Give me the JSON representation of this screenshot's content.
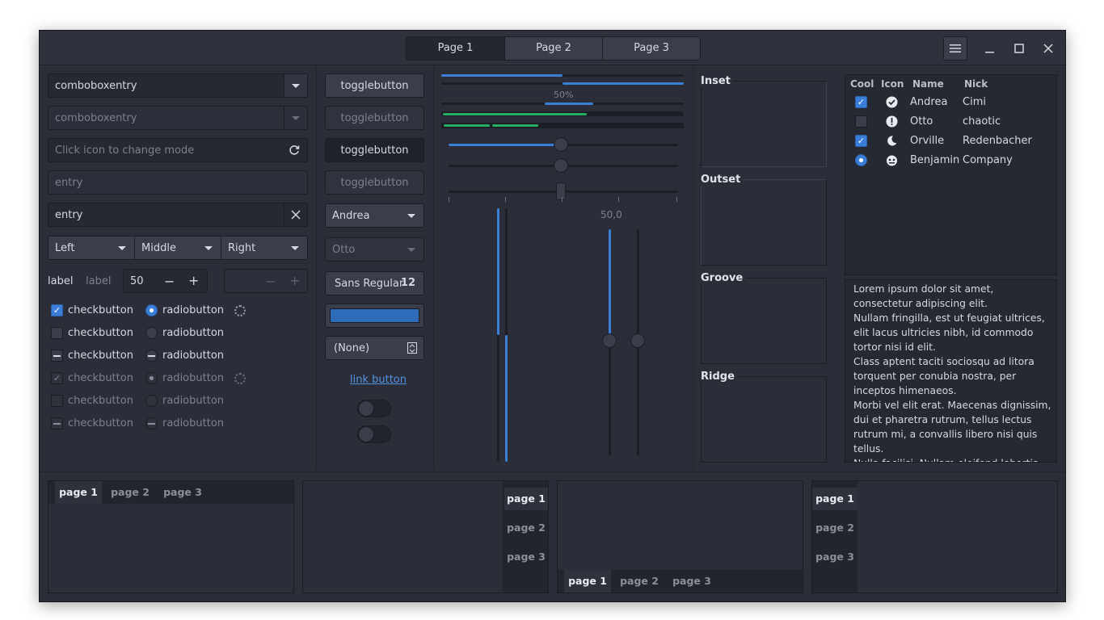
{
  "header": {
    "stack_tabs": [
      "Page 1",
      "Page 2",
      "Page 3"
    ]
  },
  "entries": {
    "combo1": "comboboxentry",
    "combo2": "comboboxentry",
    "mode_placeholder": "Click icon to change mode",
    "entry_placeholder": "entry",
    "entry_value": "entry",
    "seg": [
      "Left",
      "Middle",
      "Right"
    ],
    "label1": "label",
    "label2": "label",
    "spin_value": "50"
  },
  "checks": [
    "checkbutton",
    "checkbutton",
    "checkbutton",
    "checkbutton",
    "checkbutton",
    "checkbutton"
  ],
  "radios": [
    "radiobutton",
    "radiobutton",
    "radiobutton",
    "radiobutton",
    "radiobutton",
    "radiobutton"
  ],
  "buttons": {
    "toggles": [
      "togglebutton",
      "togglebutton",
      "togglebutton",
      "togglebutton"
    ],
    "combo_andrea": "Andrea",
    "combo_otto": "Otto",
    "font_name": "Sans Regular",
    "font_size": "12",
    "file_none": "(None)",
    "link": "link button"
  },
  "progress": {
    "label": "50%",
    "value": 0.5
  },
  "scale_value": "50,0",
  "frames": [
    "Inset",
    "Outset",
    "Groove",
    "Ridge"
  ],
  "tree": {
    "headers": [
      "Cool",
      "Icon",
      "Name",
      "Nick"
    ],
    "rows": [
      {
        "name": "Andrea",
        "nick": "Cimi",
        "cool": "checked",
        "icon": "check-circle-icon"
      },
      {
        "name": "Otto",
        "nick": "chaotic",
        "cool": "unchecked",
        "icon": "exclamation-circle-icon"
      },
      {
        "name": "Orville",
        "nick": "Redenbacher",
        "cool": "checked",
        "icon": "moon-icon"
      },
      {
        "name": "Benjamin",
        "nick": "Company",
        "cool": "radio",
        "icon": "face-icon"
      }
    ]
  },
  "textview": [
    "Lorem ipsum dolor sit amet, consectetur adipiscing elit.",
    "Nullam fringilla, est ut feugiat ultrices, elit lacus ultricies nibh, id commodo tortor nisi id elit.",
    "Class aptent taciti sociosqu ad litora torquent per conubia nostra, per inceptos himenaeos.",
    "Morbi vel elit erat. Maecenas dignissim, dui et pharetra rutrum, tellus lectus rutrum mi, a convallis libero nisi quis tellus.",
    "Nulla facilisi. Nullam eleifend lobortis nisl, in porttitor tellus malesuada vitae."
  ],
  "notebooks": [
    "page 1",
    "page 2",
    "page 3"
  ],
  "colors": {
    "accent": "#3b7ed8",
    "green": "#27ae60",
    "bg": "#2b2e39"
  }
}
